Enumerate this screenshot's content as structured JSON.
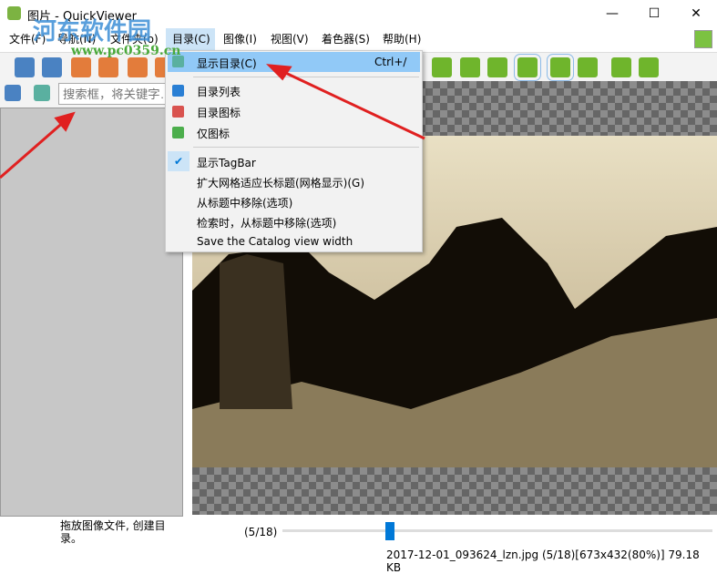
{
  "window": {
    "title": "图片 - QuickViewer",
    "minimize": "—",
    "maximize": "☐",
    "close": "✕"
  },
  "menubar": [
    "文件(F)",
    "导航(N)",
    "文件夹(o)",
    "目录(C)",
    "图像(I)",
    "视图(V)",
    "着色器(S)",
    "帮助(H)"
  ],
  "watermark": {
    "name": "河东软件园",
    "url": "www.pc0359.cn"
  },
  "search": {
    "placeholder": "搜索框，将关键字…"
  },
  "dropdown": {
    "show_catalog": "显示目录(C)",
    "show_catalog_shortcut": "Ctrl+/",
    "items": [
      "目录列表",
      "目录图标",
      "仅图标"
    ],
    "show_tagbar": "显示TagBar",
    "options": [
      "扩大网格适应长标题(网格显示)(G)",
      "从标题中移除(选项)",
      "检索时，从标题中移除(选项)",
      "Save the Catalog view width"
    ]
  },
  "status": {
    "hint": "拖放图像文件, 创建目录。",
    "counter": "(5/18)",
    "progress": 0.25,
    "fileinfo": "2017-12-01_093624_lzn.jpg (5/18)[673x432(80%)] 79.18 KB"
  },
  "colors": {
    "accent": "#0078d7",
    "arrow": "#e02020"
  }
}
